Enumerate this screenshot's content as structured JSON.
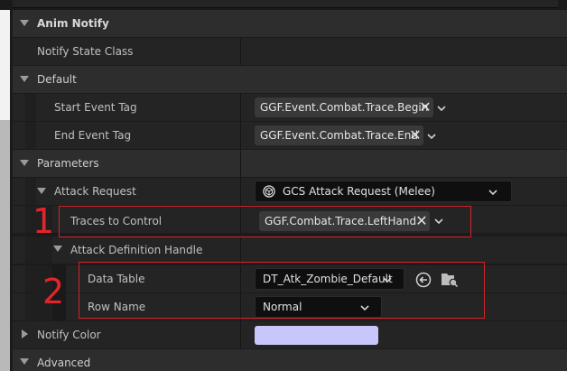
{
  "sections": {
    "anim_notify": "Anim Notify",
    "default": "Default",
    "parameters": "Parameters",
    "notify_color": "Notify Color",
    "advanced": "Advanced"
  },
  "properties": {
    "notify_state_class": {
      "label": "Notify State Class"
    },
    "start_event_tag": {
      "label": "Start Event Tag",
      "value": "GGF.Event.Combat.Trace.Begin"
    },
    "end_event_tag": {
      "label": "End Event Tag",
      "value": "GGF.Event.Combat.Trace.End"
    },
    "attack_request": {
      "label": "Attack Request",
      "value": "GCS Attack Request (Melee)"
    },
    "traces_to_control": {
      "label": "Traces to Control",
      "value": "GGF.Combat.Trace.LeftHand"
    },
    "attack_definition_handle": {
      "label": "Attack Definition Handle"
    },
    "data_table": {
      "label": "Data Table",
      "value": "DT_Atk_Zombie_Default"
    },
    "row_name": {
      "label": "Row Name",
      "value": "Normal"
    }
  },
  "annotations": {
    "one": "1",
    "two": "2"
  },
  "colors": {
    "notify_color_swatch": "#c8c6fa",
    "annotation_red": "#d0242a"
  },
  "icons": [
    "expand-arrow-icon",
    "collapse-arrow-icon",
    "clear-x-icon",
    "chevron-down-icon",
    "struct-icon",
    "browse-back-arrow-icon",
    "find-in-browser-icon"
  ]
}
